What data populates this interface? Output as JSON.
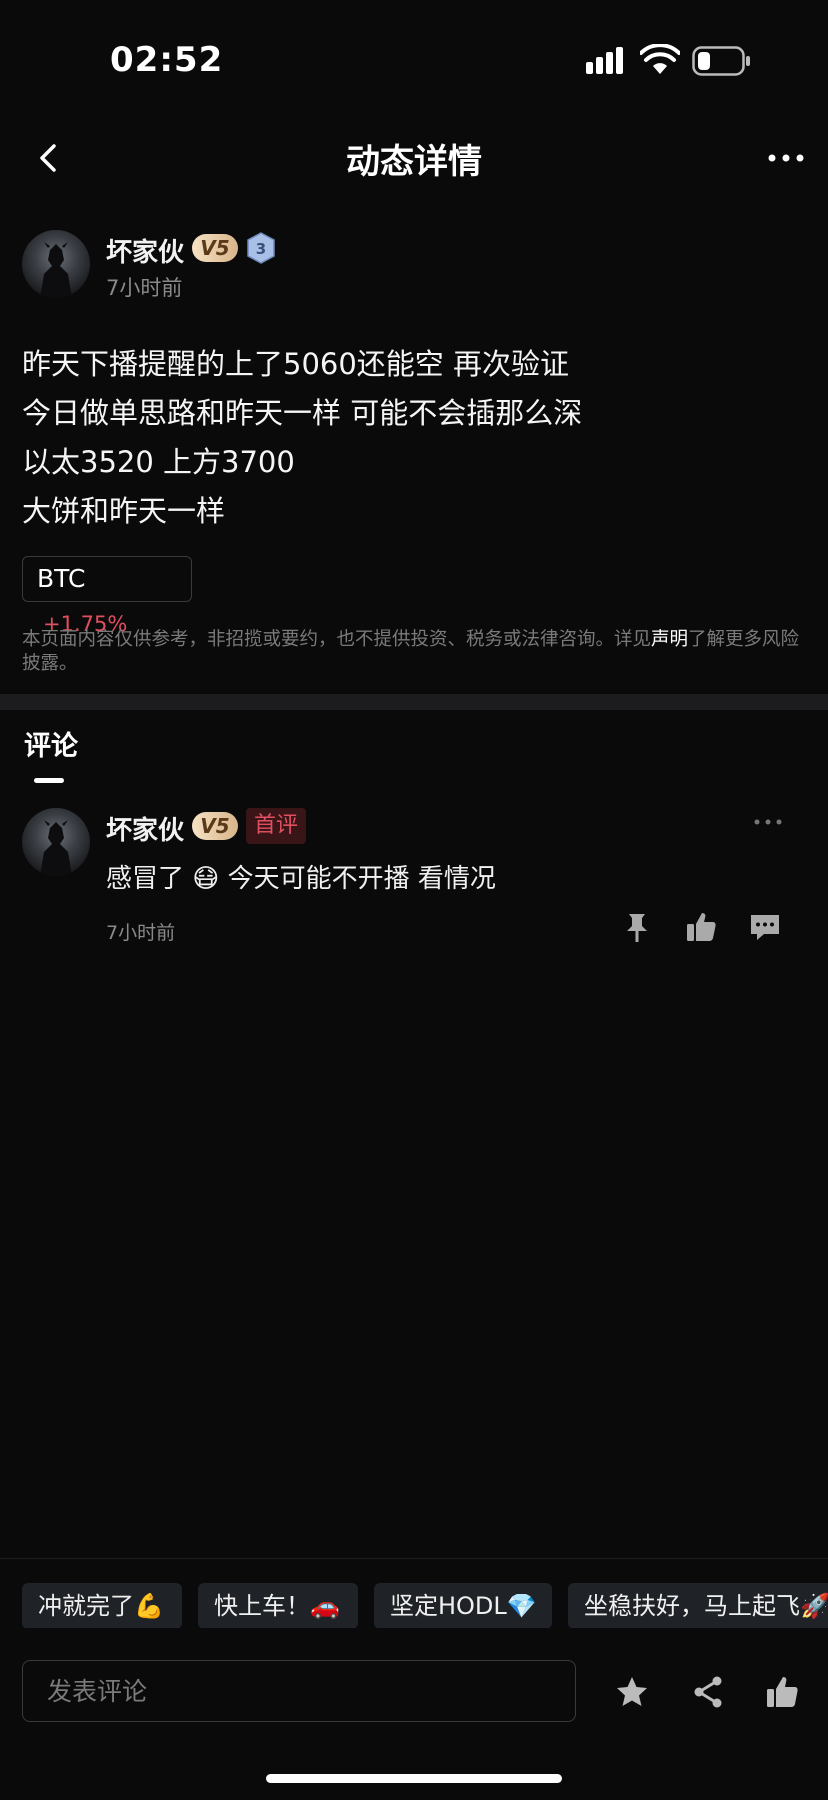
{
  "status_bar": {
    "time": "02:52"
  },
  "nav": {
    "title": "动态详情"
  },
  "post": {
    "author": "坏家伙",
    "vip": "V5",
    "level": "3",
    "time": "7小时前",
    "lines": [
      "昨天下播提醒的上了5060还能空 再次验证",
      "今日做单思路和昨天一样 可能不会插那么深",
      "以太3520 上方3700",
      "大饼和昨天一样"
    ],
    "coin": {
      "symbol": "BTC",
      "change": "+1.75%"
    },
    "disclaimer": {
      "before": "本页面内容仅供参考，非招揽或要约，也不提供投资、税务或法律咨询。详见",
      "link": "声明",
      "after": "了解更多风险披露。"
    }
  },
  "comments": {
    "tab_label": "评论",
    "items": [
      {
        "author": "坏家伙",
        "vip": "V5",
        "badge": "首评",
        "text": "感冒了 😷 今天可能不开播 看情况",
        "time": "7小时前"
      }
    ]
  },
  "quick_replies": [
    "冲就完了💪",
    "快上车！🚗",
    "坚定HODL💎",
    "坐稳扶好，马上起飞🚀"
  ],
  "input": {
    "placeholder": "发表评论"
  },
  "colors": {
    "background": "#0a0a0a",
    "negative": "#e04f5f",
    "vip_gold": "#d8b48a"
  }
}
